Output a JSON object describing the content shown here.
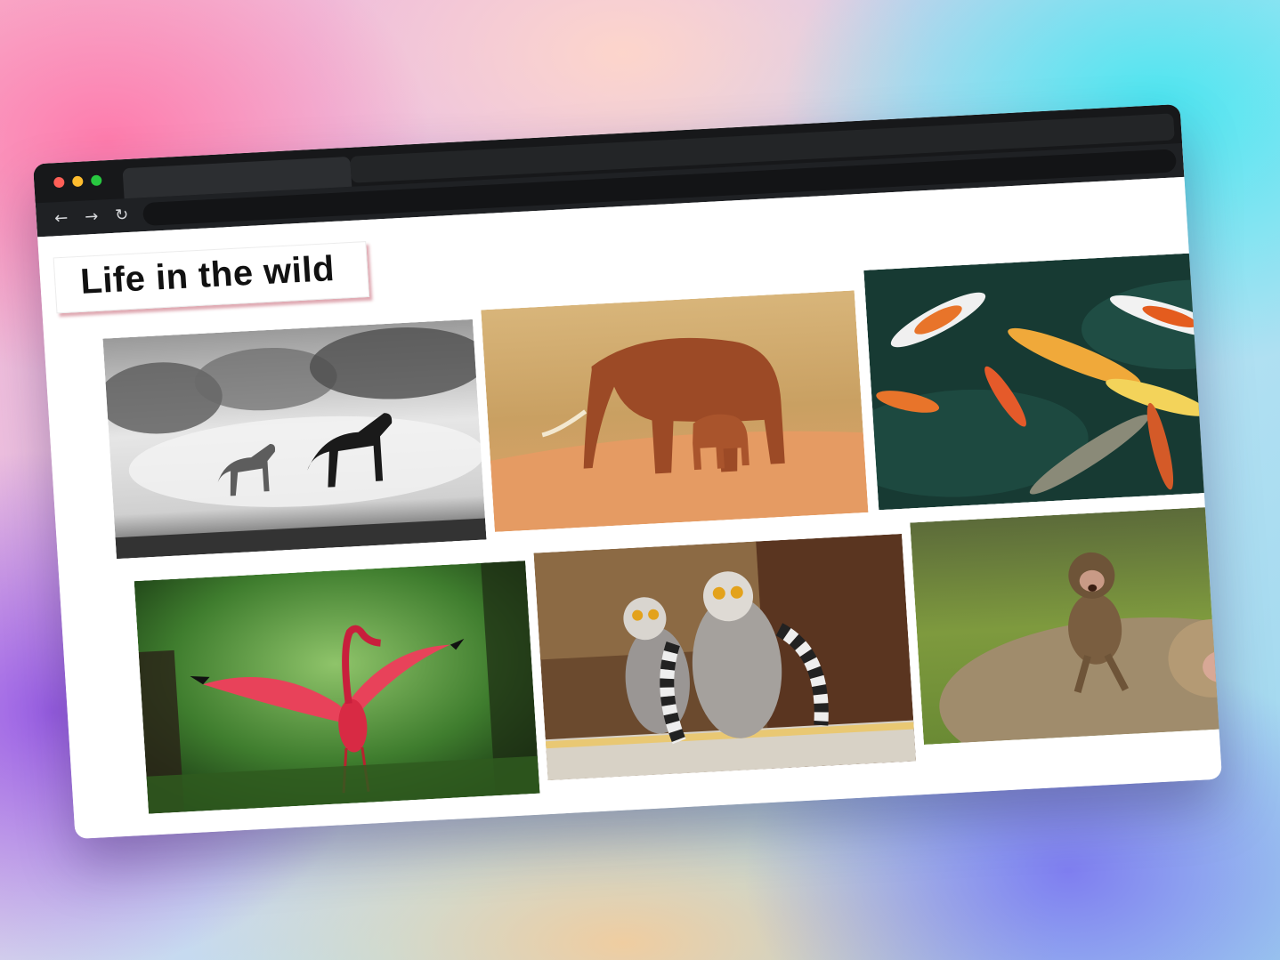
{
  "page": {
    "title": "Life in the wild"
  },
  "browser": {
    "traffic_lights": [
      "#ff5f57",
      "#febc2e",
      "#28c840"
    ],
    "nav": {
      "back_icon": "←",
      "forward_icon": "→",
      "reload_icon": "↻"
    }
  },
  "gallery": {
    "photos": [
      {
        "subject": "horses-icon"
      },
      {
        "subject": "elephants-icon"
      },
      {
        "subject": "koi-fish-icon"
      },
      {
        "subject": "scarlet-ibis-icon"
      },
      {
        "subject": "lemurs-icon"
      },
      {
        "subject": "monkeys-icon"
      }
    ]
  }
}
